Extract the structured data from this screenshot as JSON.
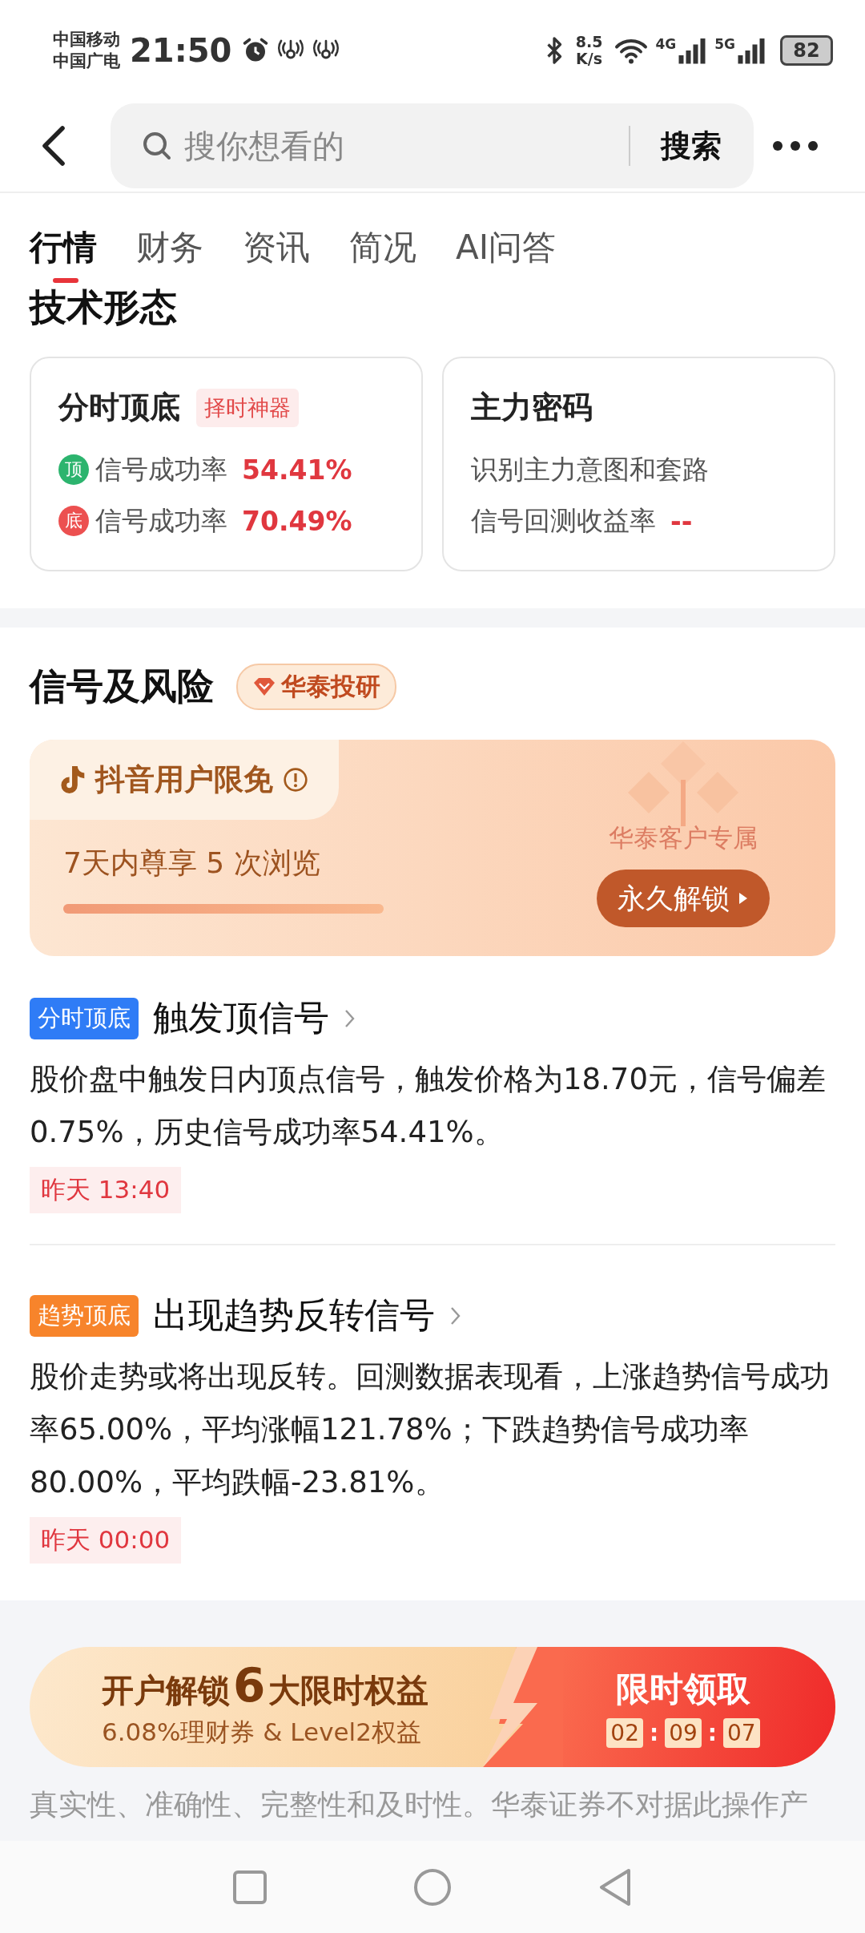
{
  "status_bar": {
    "carriers": [
      "中国移动",
      "中国广电"
    ],
    "time": "21:50",
    "speed": [
      "8.5",
      "K/s"
    ],
    "networks": [
      "4G",
      "5G"
    ],
    "battery": "82"
  },
  "search": {
    "placeholder": "搜你想看的",
    "button": "搜索"
  },
  "tabs": [
    {
      "label": "行情",
      "selected": true
    },
    {
      "label": "财务",
      "selected": false
    },
    {
      "label": "资讯",
      "selected": false
    },
    {
      "label": "简况",
      "selected": false
    },
    {
      "label": "AI问答",
      "selected": false
    }
  ],
  "tech_section": {
    "title": "技术形态",
    "cards": [
      {
        "title": "分时顶底",
        "tag": "择时神器",
        "rows": [
          {
            "badge": "顶",
            "color": "#2cb46e",
            "label": "信号成功率",
            "value": "54.41%"
          },
          {
            "badge": "底",
            "color": "#ec5050",
            "label": "信号成功率",
            "value": "70.49%"
          }
        ]
      },
      {
        "title": "主力密码",
        "description": "识别主力意图和套路",
        "rows": [
          {
            "label": "信号回测收益率",
            "value": "--"
          }
        ]
      }
    ]
  },
  "signal_section": {
    "title": "信号及风险",
    "badge": "华泰投研",
    "promo": {
      "label": "抖音用户限免",
      "text": "7天内尊享 5 次浏览",
      "level": 1,
      "exclusive": "华泰客户专属",
      "button": "永久解锁"
    },
    "signals": [
      {
        "tag": "分时顶底",
        "color": "#2f7cf6",
        "title": "触发顶信号",
        "text": "股价盘中触发日内顶点信号，触发价格为18.70元，信号偏差0.75%，历史信号成功率54.41%。",
        "time": "昨天 13:40"
      },
      {
        "tag": "趋势顶底",
        "color": "#f7842b",
        "title": "出现趋势反转信号",
        "text": "股价走势或将出现反转。回测数据表现看，上涨趋势信号成功率65.00%，平均涨幅121.78%；下跌趋势信号成功率80.00%，平均跌幅-23.81%。",
        "time": "昨天 00:00"
      }
    ]
  },
  "disclaimer": "真实性、准确性、完整性和及时性。华泰证券不对据此操作产",
  "bottom_promo": {
    "title_before": "开户解锁",
    "highlight": "6",
    "title_after": "大限时权益",
    "subtitle": "6.08%理财券 & Level2权益",
    "cta": "限时领取",
    "countdown": [
      {
        "kind": "digits",
        "text": "02"
      },
      {
        "kind": "separator",
        "text": ":"
      },
      {
        "kind": "digits",
        "text": "09"
      },
      {
        "kind": "separator",
        "text": ":"
      },
      {
        "kind": "digits",
        "text": "07"
      }
    ]
  }
}
